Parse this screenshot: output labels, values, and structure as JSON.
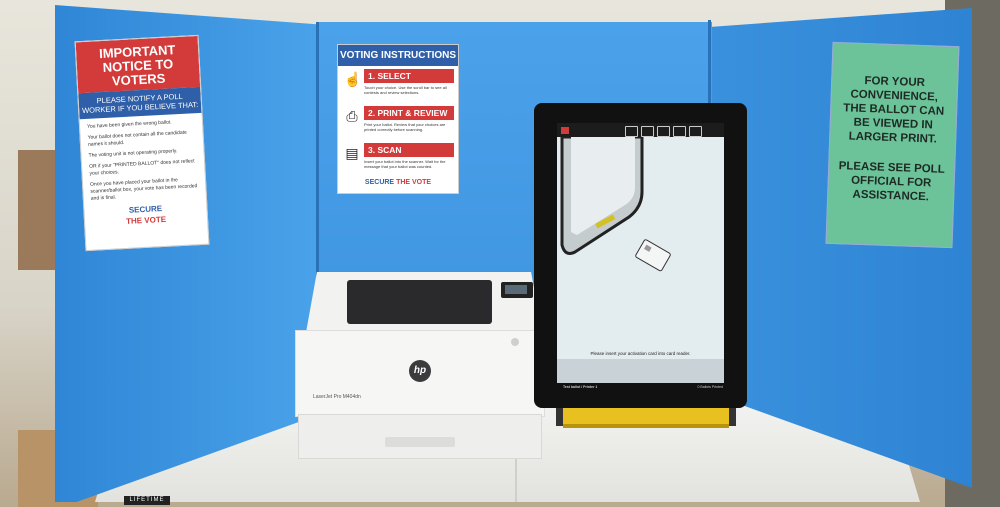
{
  "poster_left": {
    "title": "IMPORTANT NOTICE TO VOTERS",
    "subtitle": "PLEASE NOTIFY A POLL WORKER IF YOU BELIEVE THAT:",
    "bullets": [
      "You have been given the wrong ballot.",
      "Your ballot does not contain all the candidate names it should.",
      "The voting unit is not operating properly."
    ],
    "printed_ballot_note": "OR if your \"PRINTED BALLOT\" does not reflect your choices.",
    "spoiled_note": "Once you have placed your ballot in the scanner/ballot box, your vote has been recorded and is final.",
    "logo_line1": "SECURE",
    "logo_line2": "THE VOTE"
  },
  "poster_center": {
    "title": "VOTING INSTRUCTIONS",
    "steps": [
      {
        "label": "1. SELECT",
        "text": "Touch your choice. Use the scroll bar to see all contests and review selections."
      },
      {
        "label": "2. PRINT & REVIEW",
        "text": "Print your ballot. Review that your choices are printed correctly before scanning."
      },
      {
        "label": "3. SCAN",
        "text": "Insert your ballot into the scanner. Wait for the message that your ballot was counted."
      }
    ],
    "logo_line1": "SECURE",
    "logo_line2": "THE VOTE"
  },
  "poster_right": {
    "text_a": "FOR YOUR CONVENIENCE, THE BALLOT CAN BE VIEWED IN LARGER PRINT.",
    "text_b": "PLEASE SEE POLL OFFICIAL FOR ASSISTANCE."
  },
  "printer": {
    "brand": "hp",
    "model": "LaserJet Pro M404dn"
  },
  "tablet": {
    "screen_message": "Please insert your activation card into card reader.",
    "footer_left": "Test ballot / Printer 1",
    "footer_right": "0 Ballots Printed",
    "icons": [
      "zoom-icon",
      "language-icon",
      "audio-icon",
      "contrast-icon",
      "more-icon"
    ]
  },
  "table": {
    "brand_label": "LIFETIME"
  },
  "colors": {
    "booth_blue": "#3f96e0",
    "notice_red": "#d33a3a",
    "notice_blue": "#2f5fa8",
    "convenience_green": "#6cc39a",
    "stand_yellow": "#e8c020"
  }
}
